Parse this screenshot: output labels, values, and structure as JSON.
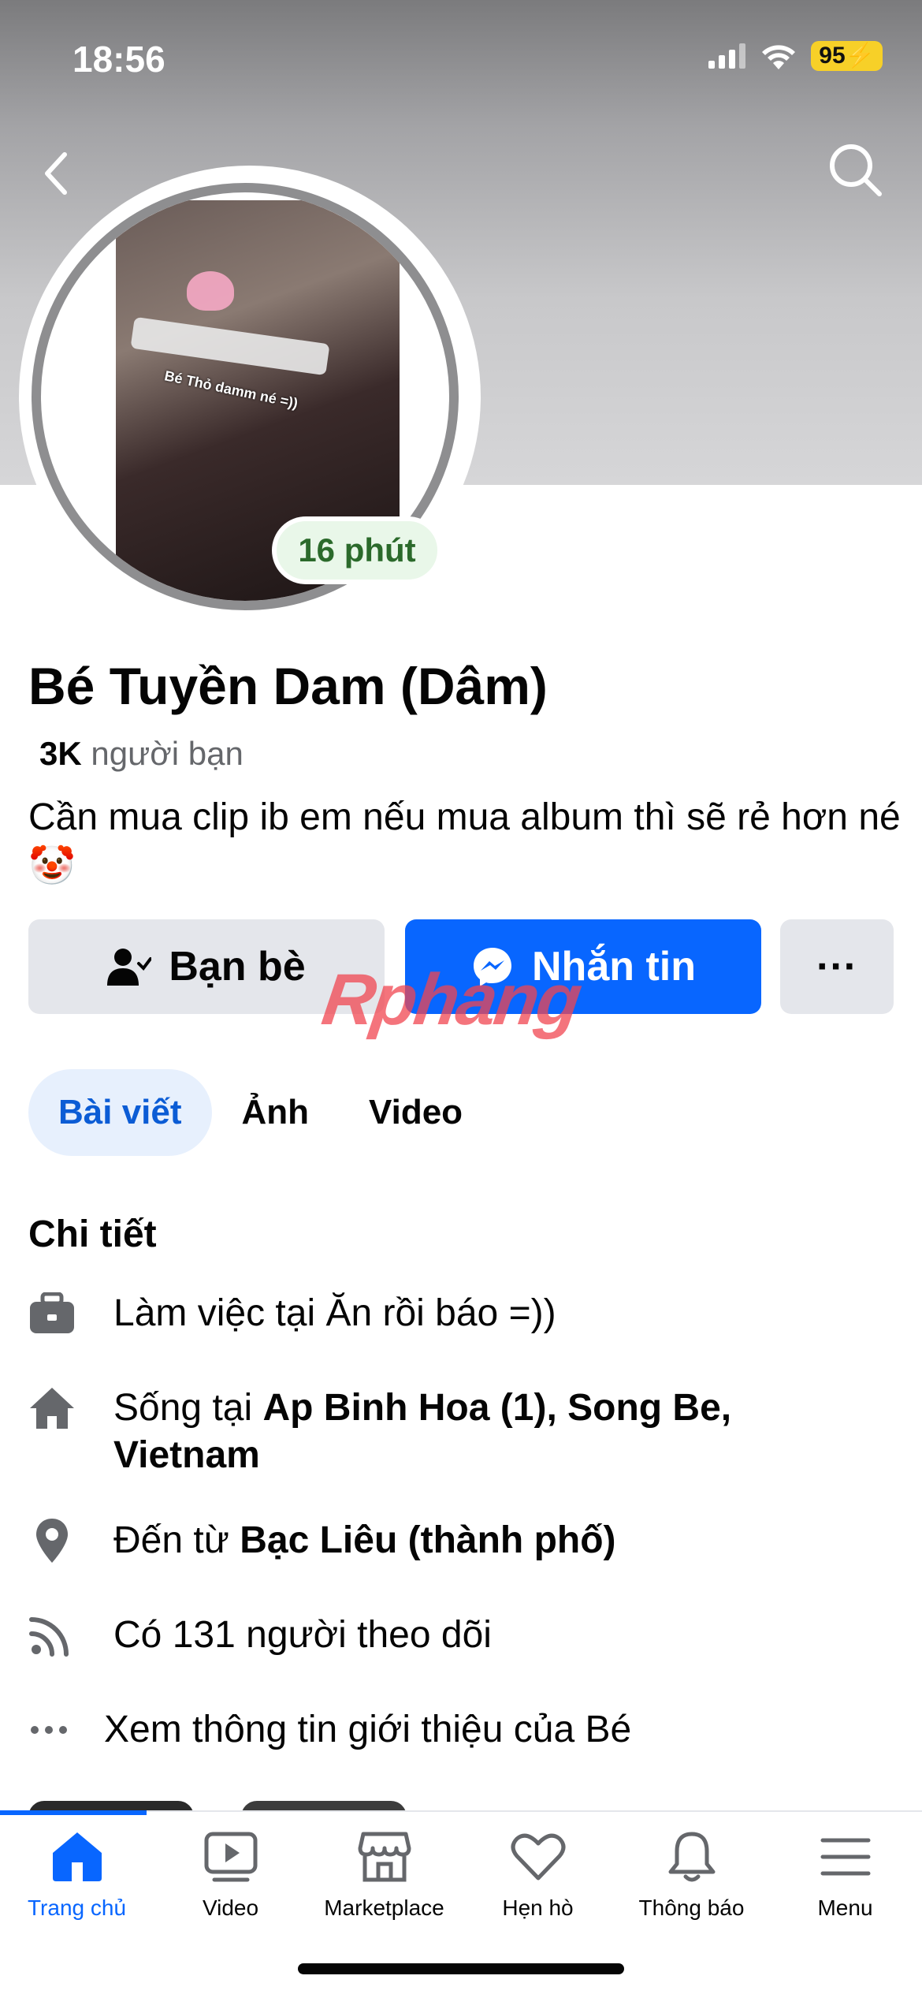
{
  "status": {
    "time": "18:56",
    "battery": "95"
  },
  "header": {
    "back_icon": "chevron-left-icon",
    "search_icon": "search-icon"
  },
  "profile": {
    "photo_caption": "Bé Thỏ damm né =))",
    "active_badge": "16 phút",
    "name": "Bé Tuyền Dam (Dâm)",
    "friends_count": "3K",
    "friends_label": " người bạn",
    "bio": "Cần mua clip ib em nếu mua album thì sẽ rẻ hơn né🤡"
  },
  "actions": {
    "friends_label": "Bạn bè",
    "message_label": "Nhắn tin",
    "more_label": "···"
  },
  "watermark": "Rphang",
  "tabs": [
    {
      "label": "Bài viết"
    },
    {
      "label": "Ảnh"
    },
    {
      "label": "Video"
    }
  ],
  "details": {
    "title": "Chi tiết",
    "work_prefix": "Làm việc tại ",
    "work_value": "Ăn rồi báo =))",
    "lives_prefix": "Sống tại ",
    "lives_value": "Ap Binh Hoa (1), Song Be, Vietnam",
    "from_prefix": "Đến từ ",
    "from_value": "Bạc Liêu (thành phố)",
    "followers": "Có 131 người theo dõi",
    "see_about": "Xem thông tin giới thiệu của Bé"
  },
  "bottom_nav": [
    {
      "label": "Trang chủ",
      "icon": "home-icon"
    },
    {
      "label": "Video",
      "icon": "video-icon"
    },
    {
      "label": "Marketplace",
      "icon": "marketplace-icon"
    },
    {
      "label": "Hẹn hò",
      "icon": "heart-icon"
    },
    {
      "label": "Thông báo",
      "icon": "bell-icon"
    },
    {
      "label": "Menu",
      "icon": "menu-icon"
    }
  ],
  "colors": {
    "accent": "#0866ff",
    "badge_bg": "#e9f7e9",
    "badge_text": "#2b6a2b"
  }
}
